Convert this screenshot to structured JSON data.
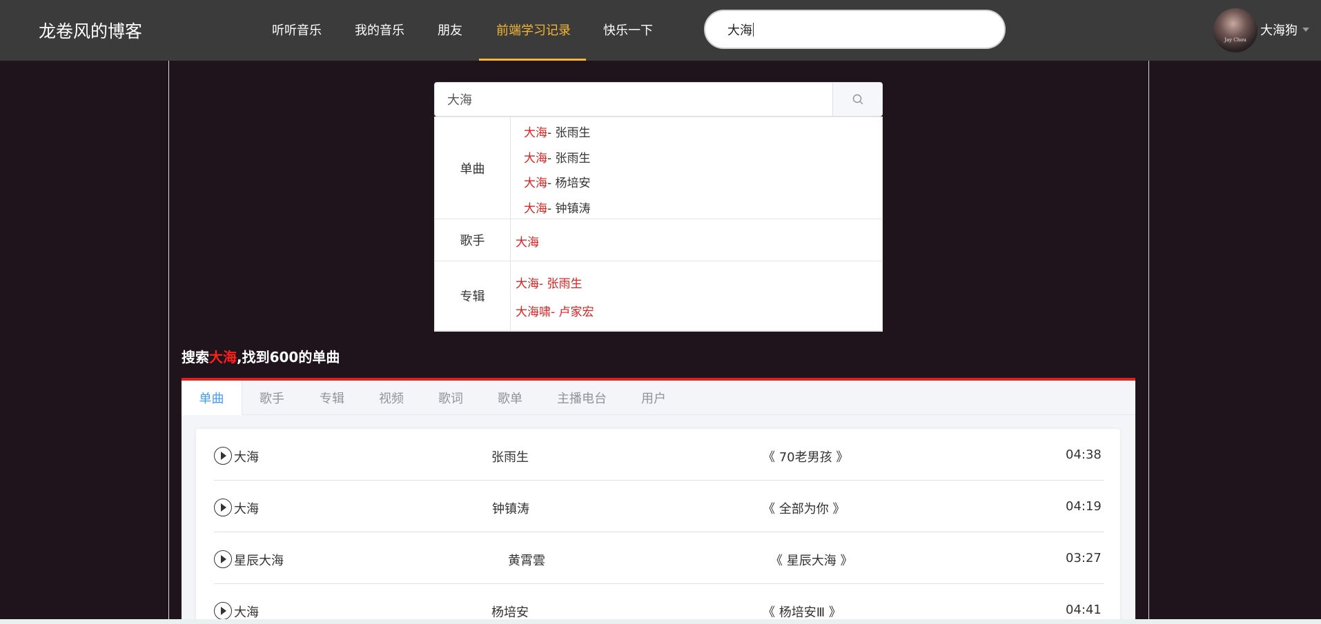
{
  "header": {
    "brand": "龙卷风的博客",
    "nav": [
      {
        "label": "听听音乐"
      },
      {
        "label": "我的音乐"
      },
      {
        "label": "朋友"
      },
      {
        "label": "前端学习记录"
      },
      {
        "label": "快乐一下"
      }
    ],
    "active_nav": "前端学习记录",
    "search_value": "大海",
    "user": {
      "name": "大海狗",
      "avatar_text": "Jay Chou"
    }
  },
  "search": {
    "value": "大海",
    "button_icon": "search-icon"
  },
  "suggestions": {
    "songs_label": "单曲",
    "songs": [
      {
        "name": "大海",
        "sep": "- ",
        "artist": "张雨生"
      },
      {
        "name": "大海",
        "sep": "- ",
        "artist": "张雨生"
      },
      {
        "name": "大海",
        "sep": "- ",
        "artist": "杨培安"
      },
      {
        "name": "大海",
        "sep": "- ",
        "artist": "钟镇涛"
      }
    ],
    "artists_label": "歌手",
    "artists": [
      {
        "name": "大海"
      }
    ],
    "albums_label": "专辑",
    "albums": [
      {
        "name": "大海",
        "sep": "- ",
        "artist": "张雨生"
      },
      {
        "name": "大海啸",
        "sep": "- ",
        "artist": "卢家宏"
      }
    ]
  },
  "results": {
    "prefix": "搜索",
    "keyword": "大海",
    "suffix": ",找到600的单曲"
  },
  "tabs": [
    {
      "label": "单曲"
    },
    {
      "label": "歌手"
    },
    {
      "label": "专辑"
    },
    {
      "label": "视频"
    },
    {
      "label": "歌词"
    },
    {
      "label": "歌单"
    },
    {
      "label": "主播电台"
    },
    {
      "label": "用户"
    }
  ],
  "active_tab": "单曲",
  "songs": [
    {
      "title": "大海",
      "artist": "张雨生",
      "album": "《 70老男孩 》",
      "duration": "04:38"
    },
    {
      "title": "大海",
      "artist": "钟镇涛",
      "album": "《 全部为你 》",
      "duration": "04:19"
    },
    {
      "title": "星辰大海",
      "artist": "黄霄雲",
      "album": "《 星辰大海 》",
      "duration": "03:27"
    },
    {
      "title": "大海",
      "artist": "杨培安",
      "album": "《 杨培安Ⅲ 》",
      "duration": "04:41"
    }
  ],
  "colors": {
    "page_bg": "#1f141c",
    "navbar_bg": "#3b3b3b",
    "active_nav": "#f7b733",
    "accent_red": "#e0201f",
    "tab_active": "#409eff"
  }
}
